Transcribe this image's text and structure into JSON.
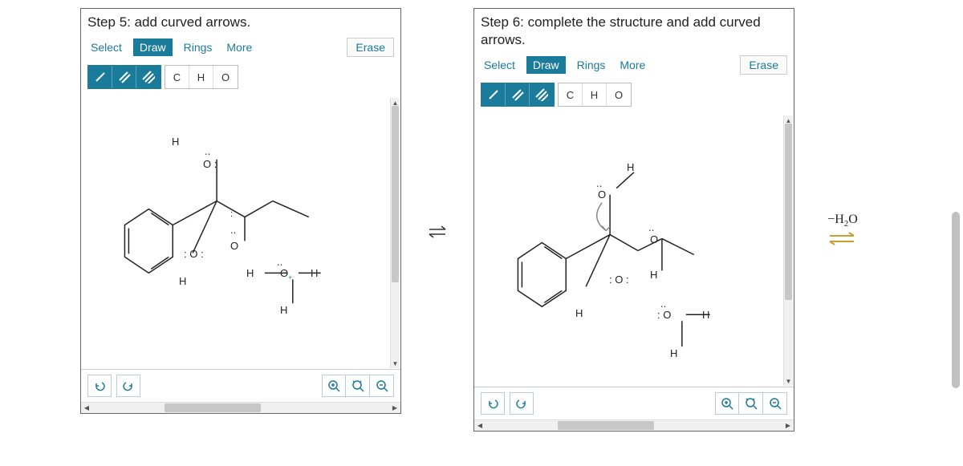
{
  "panels": [
    {
      "title": "Step 5: add curved arrows.",
      "toolbar": {
        "select": "Select",
        "draw": "Draw",
        "rings": "Rings",
        "more": "More",
        "erase": "Erase"
      },
      "atoms": {
        "c": "C",
        "h": "H",
        "o": "O"
      }
    },
    {
      "title": "Step 6: complete the structure and add curved arrows.",
      "toolbar": {
        "select": "Select",
        "draw": "Draw",
        "rings": "Rings",
        "more": "More",
        "erase": "Erase"
      },
      "atoms": {
        "c": "C",
        "h": "H",
        "o": "O"
      }
    }
  ],
  "molecule_labels": {
    "H": "H",
    "O": "O",
    "O_lone_colon": ": O :",
    "O_colon_right": "O :",
    "O_lone_left": ": O"
  },
  "rightArrow": {
    "label": "−H₂O"
  }
}
